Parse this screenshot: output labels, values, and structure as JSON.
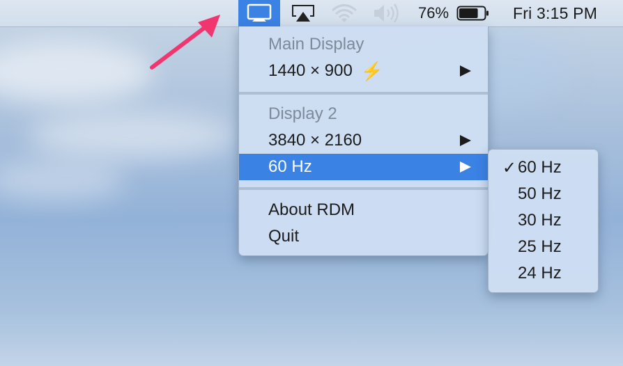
{
  "menubar": {
    "icons": [
      "display-icon",
      "airplay-icon",
      "wifi-icon",
      "volume-icon",
      "battery-icon"
    ],
    "battery_percent": "76%",
    "battery_level": 0.76,
    "clock": "Fri 3:15 PM"
  },
  "menu": {
    "main_display_header": "Main Display",
    "main_display_resolution": "1440 × 900",
    "main_display_badge": "⚡",
    "display2_header": "Display 2",
    "display2_resolution": "3840 × 2160",
    "display2_refresh": "60 Hz",
    "about": "About RDM",
    "quit": "Quit"
  },
  "submenu": {
    "checkmark": "✓",
    "items": [
      "60 Hz",
      "50 Hz",
      "30 Hz",
      "25 Hz",
      "24 Hz"
    ],
    "selected_index": 0
  },
  "colors": {
    "accent": "#3a82e4",
    "annotation_arrow": "#f0356f",
    "bolt": "#d9a33b"
  }
}
